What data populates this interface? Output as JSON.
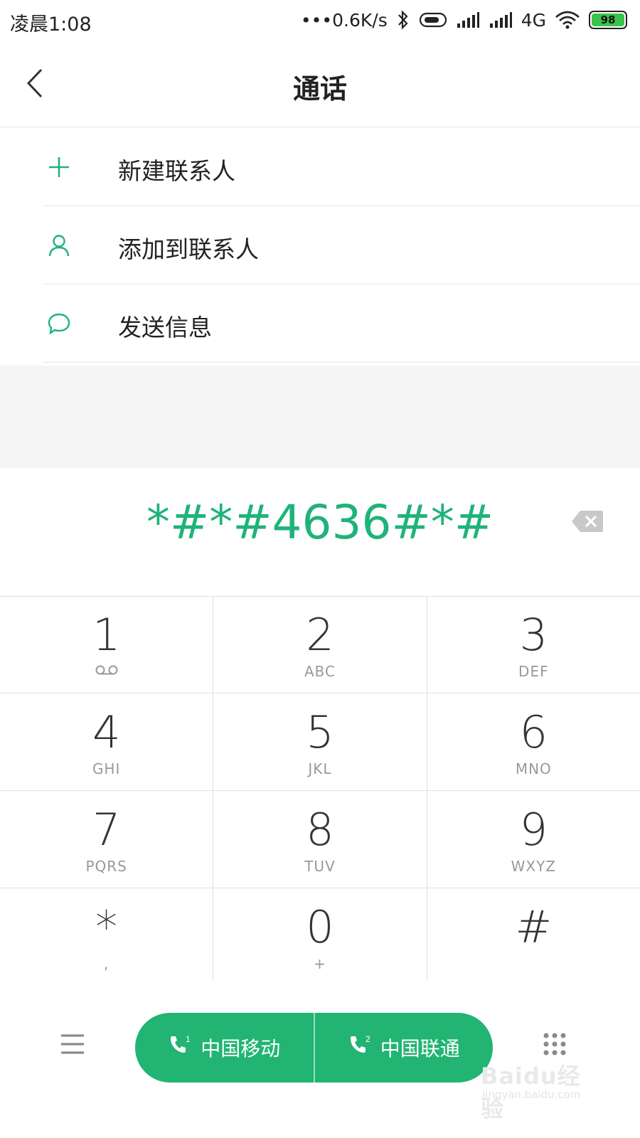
{
  "status_bar": {
    "time": "凌晨1:08",
    "net_speed": "•••0.6K/s",
    "network_type": "4G",
    "battery_level": "98",
    "icons": [
      "bluetooth-icon",
      "toggle-icon",
      "signal-icon",
      "signal-icon",
      "wifi-icon",
      "battery-icon"
    ]
  },
  "header": {
    "title": "通话",
    "back_icon": "chevron-left-icon"
  },
  "actions": [
    {
      "label": "新建联系人",
      "icon": "plus-icon"
    },
    {
      "label": "添加到联系人",
      "icon": "person-icon"
    },
    {
      "label": "发送信息",
      "icon": "chat-bubble-icon"
    }
  ],
  "dialer": {
    "number": "*#*#4636#*#",
    "backspace_icon": "backspace-icon"
  },
  "keypad": [
    [
      {
        "digit": "1",
        "letters": ""
      },
      {
        "digit": "2",
        "letters": "ABC"
      },
      {
        "digit": "3",
        "letters": "DEF"
      }
    ],
    [
      {
        "digit": "4",
        "letters": "GHI"
      },
      {
        "digit": "5",
        "letters": "JKL"
      },
      {
        "digit": "6",
        "letters": "MNO"
      }
    ],
    [
      {
        "digit": "7",
        "letters": "PQRS"
      },
      {
        "digit": "8",
        "letters": "TUV"
      },
      {
        "digit": "9",
        "letters": "WXYZ"
      }
    ],
    [
      {
        "digit": "*",
        "letters": ","
      },
      {
        "digit": "0",
        "letters": "+"
      },
      {
        "digit": "#",
        "letters": ""
      }
    ]
  ],
  "bottom_bar": {
    "sim1_label": "中国移动",
    "sim1_index": "1",
    "sim2_label": "中国联通",
    "sim2_index": "2",
    "menu_icon": "menu-icon",
    "dialpad_icon": "dialpad-icon"
  },
  "watermark": {
    "main": "Baidu经验",
    "sub": "jingyan.baidu.com"
  },
  "colors": {
    "accent": "#1fb37a",
    "call_button": "#21b473",
    "battery": "#39c34a"
  }
}
